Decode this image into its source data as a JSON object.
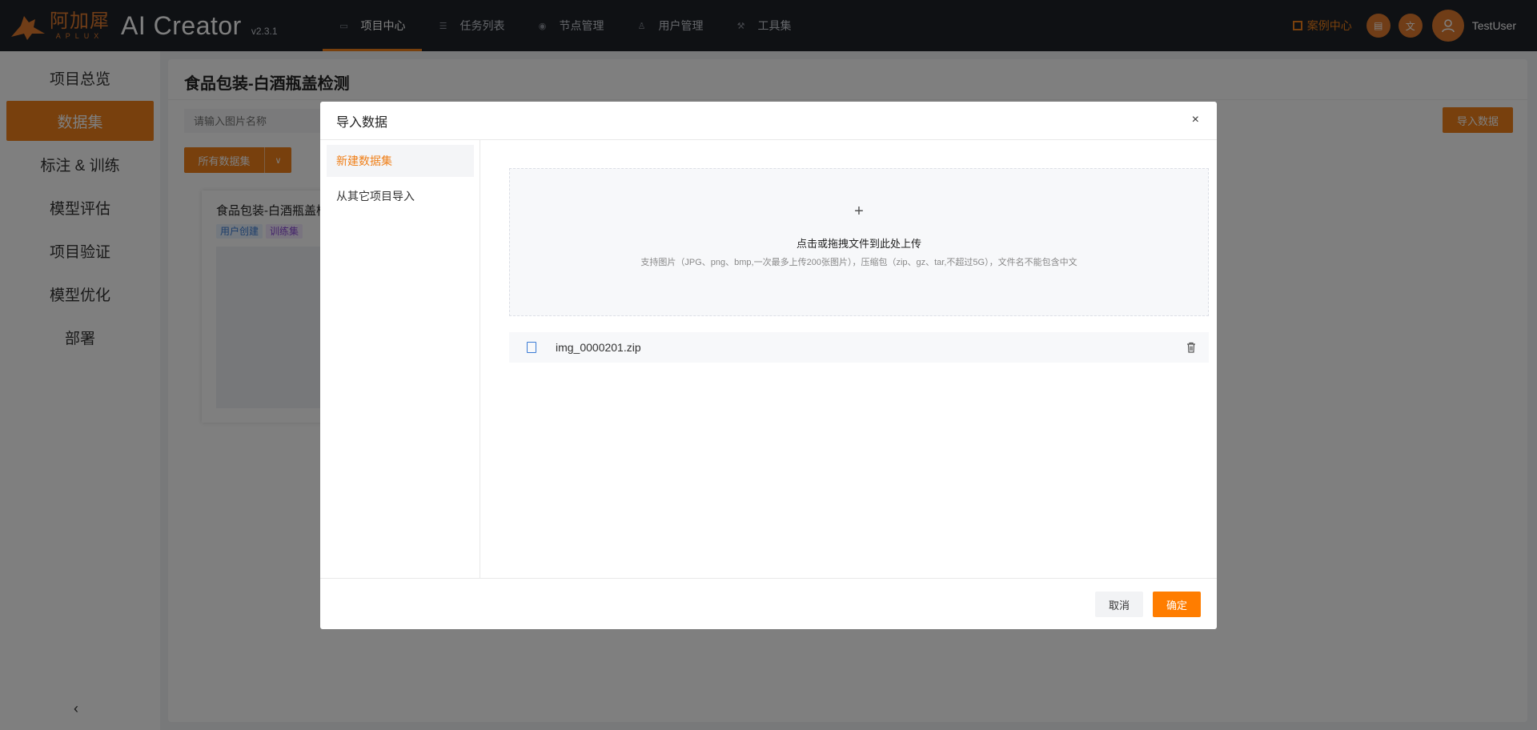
{
  "header": {
    "logo_cn": "阿加犀",
    "logo_en": "APLUX",
    "app_title": "AI Creator",
    "version": "v2.3.1",
    "nav": [
      {
        "label": "项目中心",
        "icon": "folder-icon"
      },
      {
        "label": "任务列表",
        "icon": "list-icon"
      },
      {
        "label": "节点管理",
        "icon": "node-icon"
      },
      {
        "label": "用户管理",
        "icon": "users-icon"
      },
      {
        "label": "工具集",
        "icon": "wrench-icon"
      }
    ],
    "case_center": "案例中心",
    "username": "TestUser",
    "accent_color": "#f0801a"
  },
  "sidebar": {
    "items": [
      {
        "label": "项目总览"
      },
      {
        "label": "数据集"
      },
      {
        "label": "标注 & 训练"
      },
      {
        "label": "模型评估"
      },
      {
        "label": "项目验证"
      },
      {
        "label": "模型优化"
      },
      {
        "label": "部署"
      }
    ],
    "collapse_glyph": "‹"
  },
  "main": {
    "title": "食品包装-白酒瓶盖检测",
    "search_placeholder": "请输入图片名称",
    "import_button": "导入数据",
    "dataset_filter": "所有数据集",
    "card": {
      "title": "食品包装-白酒瓶盖检测",
      "tag_source": "用户创建",
      "tag_split": "训练集"
    }
  },
  "modal": {
    "title": "导入数据",
    "close_glyph": "×",
    "tabs": [
      {
        "label": "新建数据集"
      },
      {
        "label": "从其它项目导入"
      }
    ],
    "upload": {
      "plus": "+",
      "main_text": "点击或拖拽文件到此处上传",
      "sub_text": "支持图片（JPG、png、bmp,一次最多上传200张图片），压缩包（zip、gz、tar,不超过5G），文件名不能包含中文"
    },
    "file": {
      "name": "img_0000201.zip"
    },
    "cancel": "取消",
    "confirm": "确定"
  }
}
